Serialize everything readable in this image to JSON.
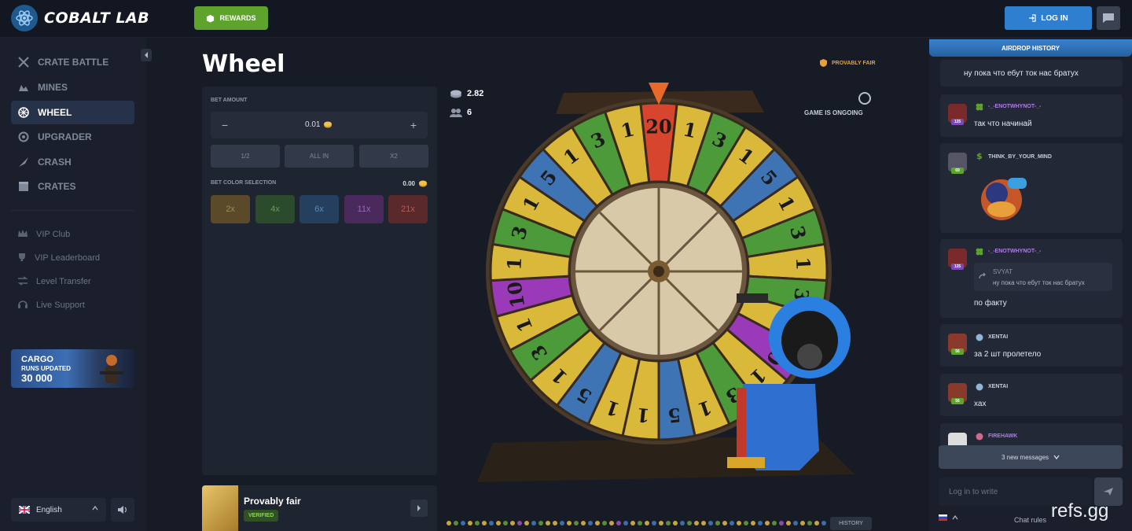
{
  "brand": {
    "name": "COBALT LAB"
  },
  "topbar": {
    "rewards_label": "REWARDS",
    "login_label": "LOG IN"
  },
  "sidebar": {
    "items": [
      {
        "label": "CRATE BATTLE",
        "icon": "swords-icon"
      },
      {
        "label": "MINES",
        "icon": "mines-icon"
      },
      {
        "label": "WHEEL",
        "icon": "wheel-icon",
        "active": true
      },
      {
        "label": "UPGRADER",
        "icon": "upgrader-icon"
      },
      {
        "label": "CRASH",
        "icon": "crash-icon"
      },
      {
        "label": "CRATES",
        "icon": "crates-icon"
      }
    ],
    "secondary": [
      {
        "label": "VIP Club",
        "icon": "crown-icon"
      },
      {
        "label": "VIP Leaderboard",
        "icon": "trophy-icon"
      },
      {
        "label": "Level Transfer",
        "icon": "transfer-icon"
      },
      {
        "label": "Live Support",
        "icon": "headset-icon"
      }
    ],
    "promo": {
      "title": "CARGO",
      "subtitle": "RUNS UPDATED",
      "amount": "30 000"
    },
    "language": "English"
  },
  "main": {
    "title": "Wheel",
    "provably_fair_label": "PROVABLY FAIR",
    "bet": {
      "amount_label": "BET AMOUNT",
      "amount_value": "0.01",
      "quick_buttons": [
        "1/2",
        "ALL IN",
        "X2"
      ],
      "color_selection_label": "BET COLOR SELECTION",
      "color_total": "0.00",
      "colors": [
        {
          "label": "2x",
          "bg": "#5a4a2a",
          "fg": "#a08a55"
        },
        {
          "label": "4x",
          "bg": "#2c4a2c",
          "fg": "#6a9a5c"
        },
        {
          "label": "6x",
          "bg": "#24405e",
          "fg": "#5f8ab9"
        },
        {
          "label": "11x",
          "bg": "#4a2a5c",
          "fg": "#9a64b8"
        },
        {
          "label": "21x",
          "bg": "#5a2a2a",
          "fg": "#b45a5a"
        }
      ]
    },
    "fair_card": {
      "title": "Provably fair",
      "badge": "VERIFIED"
    },
    "game": {
      "total_bet": "2.82",
      "players": "6",
      "status": "GAME IS ONGOING",
      "history_label": "HISTORY",
      "wheel_segments": [
        "20",
        "1",
        "3",
        "1",
        "5",
        "1",
        "3",
        "1",
        "3",
        "1",
        "10",
        "1",
        "3",
        "1",
        "5",
        "1",
        "1",
        "5",
        "1",
        "3",
        "1",
        "10",
        "1",
        "3",
        "1",
        "5",
        "1",
        "3",
        "1"
      ],
      "history_colors": [
        "#c9a43a",
        "#5c8a3a",
        "#3b6ea8",
        "#c9a43a",
        "#5c8a3a",
        "#c9a43a",
        "#3b6ea8",
        "#c9a43a",
        "#5c8a3a",
        "#c9a43a",
        "#8a4aa8",
        "#c9a43a",
        "#3b6ea8",
        "#5c8a3a",
        "#c9a43a",
        "#c9a43a",
        "#3b6ea8",
        "#c9a43a",
        "#5c8a3a",
        "#c9a43a",
        "#3b6ea8",
        "#c9a43a",
        "#5c8a3a",
        "#c9a43a",
        "#8a4aa8",
        "#3b6ea8",
        "#c9a43a",
        "#5c8a3a",
        "#c9a43a",
        "#3b6ea8",
        "#c9a43a",
        "#5c8a3a",
        "#c9a43a",
        "#3b6ea8",
        "#5c8a3a",
        "#c9a43a",
        "#c9a43a",
        "#3b6ea8",
        "#5c8a3a",
        "#c9a43a",
        "#3b6ea8",
        "#c9a43a",
        "#5c8a3a",
        "#c9a43a",
        "#3b6ea8",
        "#c9a43a",
        "#5c8a3a",
        "#8a4aa8",
        "#c9a43a",
        "#3b6ea8",
        "#c9a43a",
        "#5c8a3a",
        "#c9a43a",
        "#3b6ea8"
      ]
    }
  },
  "chat": {
    "tab_label": "AIRDROP HISTORY",
    "messages": [
      {
        "text": "ну пока что ебут ток нас братух"
      },
      {
        "user": "-_-ENOTWHYNOT-_-",
        "level": "125",
        "text": "так что начинай",
        "name_color": "#b07de8"
      },
      {
        "user": "THINK_BY_YOUR_MIND",
        "level": "69",
        "name_color": "#c7cedb"
      },
      {
        "user": "-_-ENOTWHYNOT-_-",
        "level": "125",
        "reply_user": "SVYAT",
        "reply_text": "ну пока что ебут ток нас братух",
        "text": "по факту",
        "name_color": "#b07de8"
      },
      {
        "user": "XENTAI",
        "level": "56",
        "text": "за 2 шт пролетело",
        "name_color": "#c7cedb"
      },
      {
        "user": "XENTAI",
        "level": "56",
        "text": "хах",
        "name_color": "#c7cedb"
      },
      {
        "user": "FIREHAWK",
        "name_color": "#b07de8"
      }
    ],
    "new_messages": "3 new messages",
    "input_placeholder": "Log in to write",
    "rules_label": "Chat rules"
  },
  "watermark": "refs.gg"
}
